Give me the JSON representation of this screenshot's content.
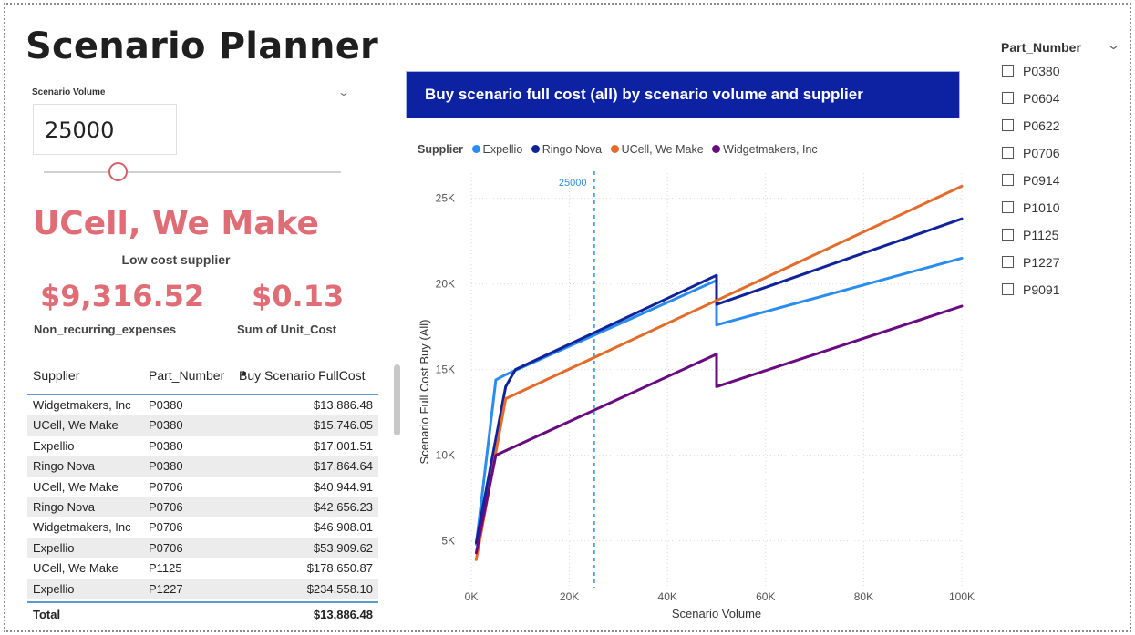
{
  "page": {
    "title": "Scenario Planner"
  },
  "volume_slicer": {
    "label": "Scenario Volume",
    "value": "25000",
    "slider_fraction": 0.25
  },
  "low_cost": {
    "supplier": "UCell, We Make",
    "label": "Low cost supplier"
  },
  "kpis": {
    "nre_value": "$9,316.52",
    "nre_label": "Non_recurring_expenses",
    "unit_value": "$0.13",
    "unit_label": "Sum of Unit_Cost"
  },
  "table": {
    "headers": {
      "supplier": "Supplier",
      "part": "Part_Number",
      "cost": "Buy Scenario FullCost"
    },
    "rows": [
      {
        "supplier": "Widgetmakers, Inc",
        "part": "P0380",
        "cost": "$13,886.48"
      },
      {
        "supplier": "UCell, We Make",
        "part": "P0380",
        "cost": "$15,746.05"
      },
      {
        "supplier": "Expellio",
        "part": "P0380",
        "cost": "$17,001.51"
      },
      {
        "supplier": "Ringo Nova",
        "part": "P0380",
        "cost": "$17,864.64"
      },
      {
        "supplier": "UCell, We Make",
        "part": "P0706",
        "cost": "$40,944.91"
      },
      {
        "supplier": "Ringo Nova",
        "part": "P0706",
        "cost": "$42,656.23"
      },
      {
        "supplier": "Widgetmakers, Inc",
        "part": "P0706",
        "cost": "$46,908.01"
      },
      {
        "supplier": "Expellio",
        "part": "P0706",
        "cost": "$53,909.62"
      },
      {
        "supplier": "UCell, We Make",
        "part": "P1125",
        "cost": "$178,650.87"
      },
      {
        "supplier": "Expellio",
        "part": "P1227",
        "cost": "$234,558.10"
      }
    ],
    "total_label": "Total",
    "total_value": "$13,886.48"
  },
  "chart_header": {
    "title": "Buy scenario full cost (all) by scenario volume and supplier"
  },
  "colors": {
    "expellio": "#2b8cf0",
    "ringo": "#10239a",
    "ucell": "#e36c2b",
    "widget": "#6a0a80",
    "accent": "#e06c75",
    "header_bg": "#0c22a3"
  },
  "chart_data": {
    "type": "line",
    "legend_title": "Supplier",
    "xlabel": "Scenario Volume",
    "ylabel": "Scenario Full Cost Buy (All)",
    "xlim": [
      0,
      100000
    ],
    "ylim": [
      2000,
      27000
    ],
    "xticks": [
      0,
      20000,
      40000,
      60000,
      80000,
      100000
    ],
    "xtick_labels": [
      "0K",
      "20K",
      "40K",
      "60K",
      "80K",
      "100K"
    ],
    "yticks": [
      5000,
      10000,
      15000,
      20000,
      25000
    ],
    "ytick_labels": [
      "5K",
      "10K",
      "15K",
      "20K",
      "25K"
    ],
    "reference_line": {
      "x": 25000,
      "label": "25000"
    },
    "grid": true,
    "legend_position": "top",
    "series": [
      {
        "name": "Expellio",
        "color": "#2b8cf0",
        "points": [
          [
            1000,
            4800
          ],
          [
            5000,
            14400
          ],
          [
            7000,
            14700
          ],
          [
            50000,
            20200
          ],
          [
            50000,
            17600
          ],
          [
            100000,
            21500
          ]
        ]
      },
      {
        "name": "Ringo Nova",
        "color": "#10239a",
        "points": [
          [
            1000,
            4900
          ],
          [
            7000,
            14000
          ],
          [
            9000,
            15000
          ],
          [
            50000,
            20500
          ],
          [
            50000,
            18800
          ],
          [
            100000,
            23800
          ]
        ]
      },
      {
        "name": "UCell, We Make",
        "color": "#e36c2b",
        "points": [
          [
            1000,
            3900
          ],
          [
            7000,
            13300
          ],
          [
            100000,
            25700
          ]
        ]
      },
      {
        "name": "Widgetmakers, Inc",
        "color": "#6a0a80",
        "points": [
          [
            1000,
            4300
          ],
          [
            5000,
            10000
          ],
          [
            50000,
            15900
          ],
          [
            50000,
            14000
          ],
          [
            100000,
            18700
          ]
        ]
      }
    ]
  },
  "filter": {
    "title": "Part_Number",
    "items": [
      "P0380",
      "P0604",
      "P0622",
      "P0706",
      "P0914",
      "P1010",
      "P1125",
      "P1227",
      "P9091"
    ]
  }
}
